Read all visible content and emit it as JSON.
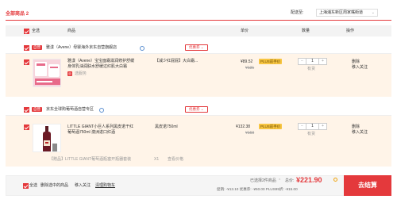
{
  "header": {
    "all_goods_label": "全部商品",
    "all_goods_count": "2",
    "ship_to_label": "配送至:",
    "ship_to_value": "上海浦东新区周家嘴街道"
  },
  "columns": {
    "select_all": "全选",
    "goods": "商品",
    "price": "单价",
    "quantity": "数量",
    "operation": "操作"
  },
  "shops": [
    {
      "tag": "自营",
      "name": "雅漾（Avene）母婴海外京东自营旗舰店",
      "coupon": "优惠券",
      "item": {
        "title_line1": "雅漾（Avene）宝宝面霜滋润修护舒缓",
        "title_line2": "身体乳油润肤水舒缓过红肌大白霜",
        "service": "选服务",
        "spec": "【减少红屁屁】大白霜...",
        "price": "¥89.52",
        "plus_badge": "PLUS前手价",
        "original_price": "¥131",
        "qty": "1",
        "stock": "有货",
        "actions": [
          "删除",
          "移入关注"
        ]
      }
    },
    {
      "tag": "自营",
      "name": "京东全球购葡萄酒自营专区",
      "coupon": "优惠券",
      "item": {
        "title_line1": "LITTLE GIANT小巨人系列黑皮诺干红",
        "title_line2": "葡萄酒750ml 澳洲进口红酒",
        "spec": "黑皮诺750ml",
        "price": "¥132.38",
        "plus_badge": "PLUS前手价",
        "original_price": "¥169",
        "qty": "1",
        "stock": "有货",
        "actions": [
          "删除",
          "移入关注"
        ]
      },
      "gift_line": "【赠品】LITTLE GIANT葡萄酒瓶塞开瓶器套装",
      "gift_qty": "X1",
      "gift_link": "查看价格"
    }
  ],
  "footer": {
    "select_all": "全选",
    "delete_selected": "删除选中的商品",
    "move_to_follow": "移入关注",
    "clear_cart": "清理购物车",
    "selected_text": "已选择2件商品",
    "total_label": "总价:",
    "total": "¥221.90",
    "discount_line": "促销: -¥13.10  优惠券: -¥50.00  PLUS95折: -¥15.00",
    "checkout": "去结算"
  },
  "colors": {
    "accent": "#e4393c",
    "row_bg": "#fff4e8",
    "plus_badge_bg": "#f7c542",
    "footer_bg": "#f5f5f5"
  }
}
